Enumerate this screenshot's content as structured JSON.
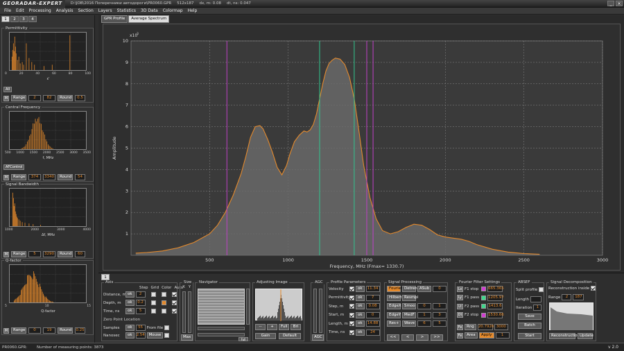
{
  "app": {
    "logo": "GEORADAR-EXPERT",
    "path": "D:\\JOB\\2016 Поперечники автодороги\\PR0060.GPR",
    "size": "512x187",
    "dx": "dx, m: 0.08",
    "dt": "dt, ns: 0.047"
  },
  "menu": [
    "File",
    "Edit",
    "Processing",
    "Analysis",
    "Section",
    "Layers",
    "Statistics",
    "3D Data",
    "Colormap",
    "Help"
  ],
  "left_tabs": [
    "1",
    "2",
    "3",
    "4"
  ],
  "panels": [
    {
      "title": "Permittivity",
      "ticks": [
        "0",
        "20",
        "40",
        "60",
        "80",
        "100"
      ],
      "xlabel": "ε'",
      "btn": "All",
      "m": "M",
      "range": "Range",
      "v1": "2",
      "v2": "82",
      "round": "Round",
      "rv": "0.5"
    },
    {
      "title": "Central Frequency",
      "ticks": [
        "500",
        "1000",
        "1500",
        "2000",
        "2500",
        "3000",
        "3500"
      ],
      "xlabel": "f, MHz",
      "btn": "AFControl",
      "m": "M",
      "range": "Range",
      "v1": "374",
      "v2": "3340",
      "round": "Round",
      "rv": "54"
    },
    {
      "title": "Signal Bandwidth",
      "ticks": [
        "1000",
        "2000",
        "3000",
        "4000"
      ],
      "xlabel": "Δf, MHz",
      "btn": "",
      "m": "M",
      "range": "Range",
      "v1": "5",
      "v2": "3290",
      "round": "Round",
      "rv": "60"
    },
    {
      "title": "Q-factor",
      "ticks": [
        "5",
        "10",
        "15"
      ],
      "xlabel": "Q-factor",
      "btn": "",
      "m": "M",
      "range": "Range",
      "v1": "0",
      "v2": "19",
      "round": "Round",
      "rv": "0.25"
    }
  ],
  "main_tabs": [
    "GPR Profile",
    "Average Spectrum"
  ],
  "chart_data": {
    "type": "area",
    "xlabel": "Frequency, MHz (Fmax= 1330.7)",
    "ylabel": "Amplitude",
    "yscale_label": "x10",
    "yscale_exp": "3",
    "xlim": [
      0,
      3000
    ],
    "ylim": [
      0,
      10
    ],
    "xticks": [
      "500",
      "1000",
      "1500",
      "2000",
      "2500",
      "3000"
    ],
    "yticks": [
      "1",
      "2",
      "3",
      "4",
      "5",
      "6",
      "7",
      "8",
      "9",
      "10"
    ],
    "x": [
      30,
      100,
      200,
      300,
      400,
      500,
      550,
      600,
      650,
      700,
      730,
      760,
      790,
      820,
      840,
      870,
      900,
      930,
      960,
      990,
      1010,
      1040,
      1070,
      1100,
      1120,
      1140,
      1160,
      1180,
      1200,
      1220,
      1240,
      1260,
      1280,
      1300,
      1330,
      1360,
      1390,
      1420,
      1450,
      1480,
      1520,
      1560,
      1600,
      1650,
      1700,
      1750,
      1800,
      1850,
      1900,
      1950,
      2000,
      2050,
      2100,
      2150,
      2200,
      2300,
      2400,
      2500,
      2600
    ],
    "y": [
      0.1,
      0.13,
      0.2,
      0.35,
      0.6,
      1.0,
      1.4,
      2.0,
      2.8,
      3.8,
      4.6,
      5.5,
      6.0,
      6.05,
      5.9,
      5.4,
      4.8,
      4.1,
      3.75,
      4.2,
      4.7,
      5.3,
      5.6,
      5.8,
      5.75,
      5.85,
      6.1,
      6.6,
      7.3,
      8.0,
      8.6,
      8.95,
      9.1,
      9.2,
      9.15,
      8.9,
      8.3,
      7.3,
      5.8,
      4.2,
      2.7,
      1.7,
      1.15,
      1.0,
      1.1,
      1.3,
      1.45,
      1.4,
      1.2,
      0.95,
      0.85,
      0.8,
      0.75,
      0.65,
      0.5,
      0.28,
      0.15,
      0.08,
      0.05
    ],
    "vlines": [
      {
        "x": 610,
        "color": "#c040c8"
      },
      {
        "x": 1200,
        "color": "#30c890"
      },
      {
        "x": 1420,
        "color": "#30c890"
      },
      {
        "x": 1500,
        "color": "#c040c8"
      },
      {
        "x": 1540,
        "color": "#c040c8"
      }
    ]
  },
  "bottom_tab": "1",
  "axis": {
    "title": "Axis",
    "step": "Step",
    "grid": "Grid",
    "color": "Color",
    "auto": "Auto",
    "rows": [
      {
        "label": "Distance, m",
        "btn": "ok",
        "val": "2"
      },
      {
        "label": "Depth, m",
        "btn": "ok",
        "val": "0.2"
      },
      {
        "label": "Time, ns",
        "btn": "ok",
        "val": "5"
      }
    ],
    "zero": "Zero Point Location",
    "samples": "Samples",
    "samples_btn": "ok",
    "samples_val": "55",
    "fromfile": "From file",
    "nanosec": "Nanosec",
    "nanosec_btn": "ok",
    "nanosec_val": "2.54",
    "mouse": "Mouse"
  },
  "size": {
    "title": "Size",
    "x": "X",
    "y": "Y",
    "max": "Max"
  },
  "navigator": {
    "title": "Navigator",
    "full": "Full"
  },
  "adjust": {
    "title": "Adjusting Image",
    "gain": "Gain",
    "default": "Default",
    "b1": "--",
    "b2": "+",
    "b3": "Full",
    "b4": "Bri"
  },
  "agc": {
    "title": "AGC",
    "btn": "AGC"
  },
  "profile": {
    "title": "Profile Parameters",
    "rows": [
      {
        "label": "Velocity",
        "btn": "ok",
        "val": "11.34"
      },
      {
        "label": "Permittivity",
        "btn": "ok",
        "val": "7"
      },
      {
        "label": "Step, m",
        "btn": "ok",
        "val": "0.08"
      },
      {
        "label": "Start, m",
        "btn": "ok",
        "val": "0"
      },
      {
        "label": "Length, m",
        "btn": "ok",
        "val": "14.88"
      },
      {
        "label": "Time, ns",
        "btn": "ok",
        "val": "24"
      }
    ]
  },
  "signal": {
    "title": "Signal Processing",
    "rows": [
      [
        "Fourier",
        "Detrend",
        "ASub",
        "0"
      ],
      [
        "Hilbert",
        "Resmpl",
        "",
        ""
      ],
      [
        "EdgeX",
        "Smoo",
        "0",
        "1"
      ],
      [
        "EdgeY",
        "MedF",
        "1",
        "3"
      ],
      [
        "Res+",
        "Wave",
        "6",
        "5"
      ]
    ],
    "nav": [
      "<<",
      "<",
      ">",
      ">>"
    ]
  },
  "fourier": {
    "title": "Fourier Filter Settings",
    "rows": [
      {
        "k": "Lx",
        "label": "F1 stop",
        "val": "665.365"
      },
      {
        "k": "Ly",
        "label": "F1 pass",
        "val": "1205.97"
      },
      {
        "k": "Lt",
        "label": "F2 pass",
        "val": "1413.6"
      },
      {
        "k": "Dt",
        "label": "F2 stop",
        "val": "1530.66"
      }
    ],
    "rng": "Rng",
    "rngv": "20.7926",
    "rngv2": "3000",
    "fe": "Fe",
    "area": "Area",
    "apply": "Apply",
    "applyv": "1"
  },
  "absef": {
    "title": "ABSEF",
    "split": "Split profile",
    "length": "Length",
    "iteration": "Iteration",
    "iterv": "1",
    "save": "Save",
    "batch": "Batch",
    "start": "Start"
  },
  "decomp": {
    "title": "Signal Decomposition",
    "recon": "Reconstruction inside",
    "range": "Range",
    "r1": "2",
    "r2": "187",
    "recbtn": "Reconstruction",
    "update": "Update"
  },
  "status": {
    "file": "PR0060.GPR:",
    "points": "Number of measuring points: 3873",
    "version": "v 2.0"
  }
}
